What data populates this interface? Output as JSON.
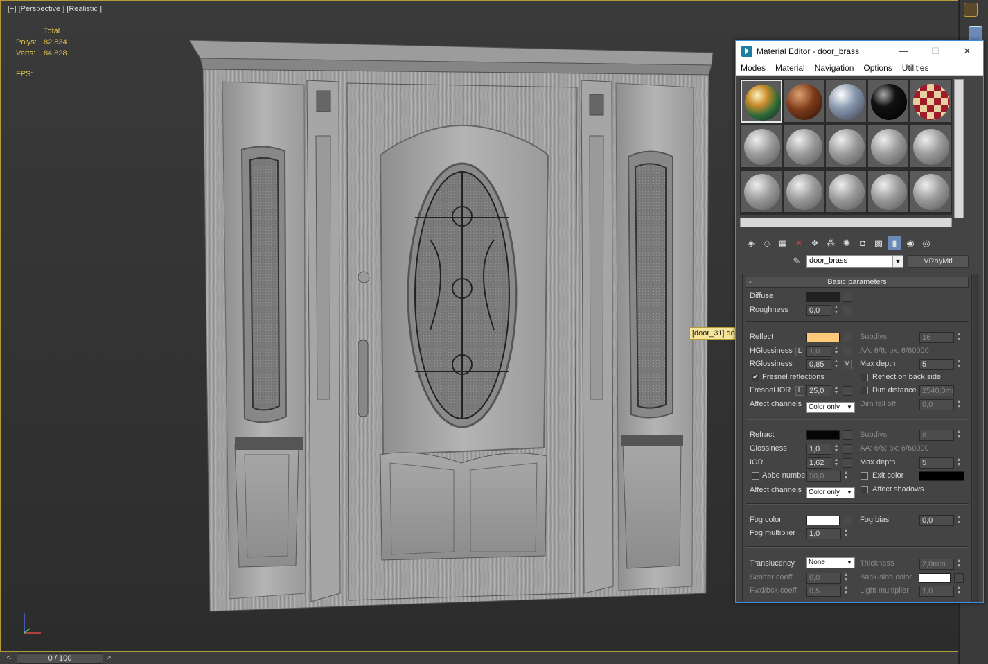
{
  "viewport": {
    "label": "[+] [Perspective ] [Realistic ]",
    "stats": {
      "header": "Total",
      "polys_label": "Polys:",
      "polys": "82 834",
      "verts_label": "Verts:",
      "verts": "84 828",
      "fps_label": "FPS:"
    },
    "tooltip": "[door_31] do"
  },
  "timeline": {
    "frame": "0 / 100",
    "prev": "<",
    "next": ">"
  },
  "material_editor": {
    "title": "Material Editor - door_brass",
    "window_buttons": {
      "minimize": "—",
      "maximize": "☐",
      "close": "✕"
    },
    "menu": [
      "Modes",
      "Material",
      "Navigation",
      "Options",
      "Utilities"
    ],
    "material_name": "door_brass",
    "material_type": "VRayMtl",
    "rollout_title": "Basic parameters",
    "rollout_toggle": "-",
    "colors": {
      "diffuse": "#202020",
      "reflect": "#ffc97a",
      "refract": "#050505",
      "fog": "#ffffff",
      "exit": "#000000",
      "backside": "#ffffff",
      "accent": "#3c8fd8"
    },
    "diffuse": {
      "label": "Diffuse",
      "roughness_label": "Roughness",
      "roughness": "0,0"
    },
    "reflect": {
      "label": "Reflect",
      "subdivs_label": "Subdivs",
      "subdivs": "16",
      "aa": "AA: 6/6; px: 6/60000",
      "hgloss_label": "HGlossiness",
      "hgloss_lock": "L",
      "hgloss": "1,0",
      "maxdepth_label": "Max depth",
      "maxdepth": "5",
      "rgloss_label": "RGlossiness",
      "rgloss": "0,85",
      "rgloss_m": "M",
      "fresnel_label": "Fresnel reflections",
      "fresnel_checked": "✔",
      "backside_label": "Reflect on back side",
      "fior_label": "Fresnel IOR",
      "fior_lock": "L",
      "fior": "25,0",
      "dimdist_label": "Dim distance",
      "dimdist": "2540,0mr",
      "affect_label": "Affect channels",
      "affect": "Color only",
      "dimfall_label": "Dim fall off",
      "dimfall": "0,0"
    },
    "refract": {
      "label": "Refract",
      "subdivs_label": "Subdivs",
      "subdivs": "8",
      "gloss_label": "Glossiness",
      "gloss": "1,0",
      "aa": "AA: 6/6; px: 6/60000",
      "ior_label": "IOR",
      "ior": "1,62",
      "maxdepth_label": "Max depth",
      "maxdepth": "5",
      "abbe_label": "Abbe number",
      "abbe": "50,0",
      "exit_label": "Exit color",
      "affect_label": "Affect channels",
      "affect": "Color only",
      "shadows_label": "Affect shadows"
    },
    "fog": {
      "color_label": "Fog color",
      "bias_label": "Fog bias",
      "bias": "0,0",
      "mult_label": "Fog multiplier",
      "mult": "1,0"
    },
    "translucency": {
      "label": "Translucency",
      "value": "None",
      "thickness_label": "Thickness",
      "thickness": "2,0mm",
      "scatter_label": "Scatter coeff",
      "scatter": "0,0",
      "backside_label": "Back-side color",
      "fwd_label": "Fwd/bck coeff",
      "fwd": "0,5",
      "light_label": "Light multiplier",
      "light": "1,0"
    }
  }
}
